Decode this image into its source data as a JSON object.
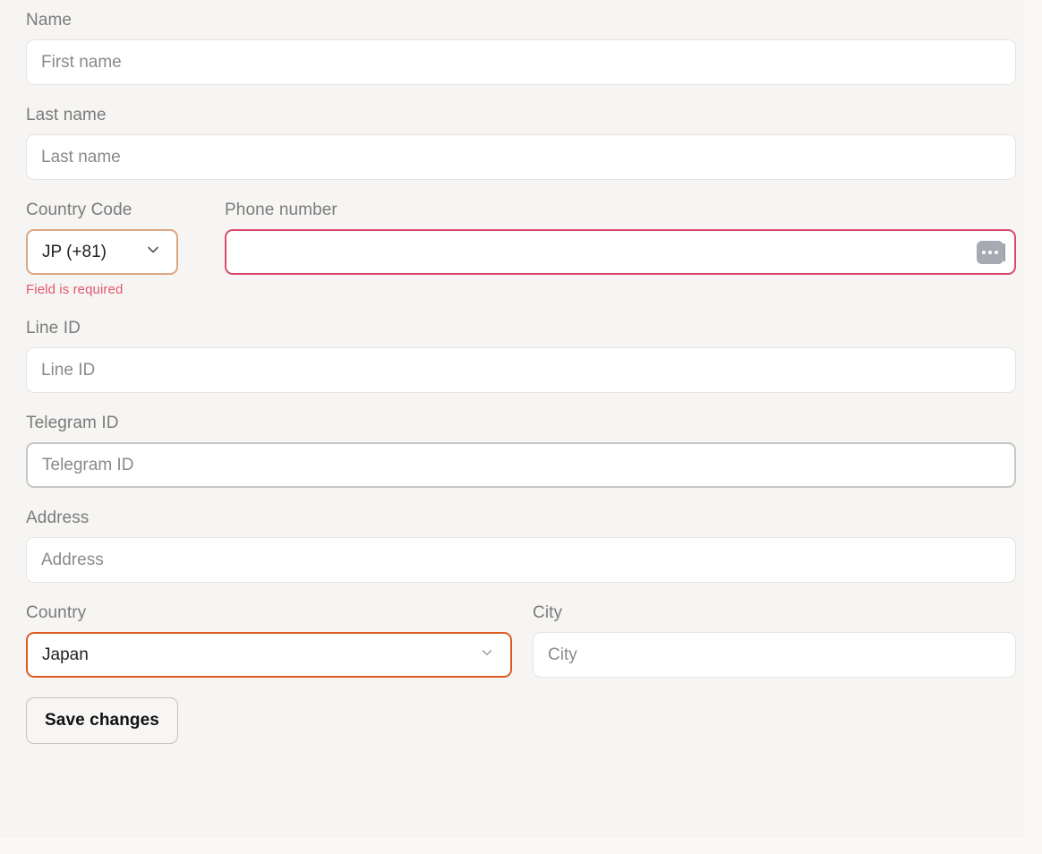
{
  "form": {
    "fields": {
      "name": {
        "label": "Name",
        "placeholder": "First name",
        "value": ""
      },
      "last_name": {
        "label": "Last name",
        "placeholder": "Last name",
        "value": ""
      },
      "country_code": {
        "label": "Country Code",
        "selected": "JP (+81)",
        "error": "Field is required"
      },
      "phone_number": {
        "label": "Phone number",
        "placeholder": "",
        "value": "",
        "state": "invalid"
      },
      "line_id": {
        "label": "Line ID",
        "placeholder": "Line ID",
        "value": ""
      },
      "telegram_id": {
        "label": "Telegram ID",
        "placeholder": "Telegram ID",
        "value": "",
        "state": "hovered"
      },
      "address": {
        "label": "Address",
        "placeholder": "Address",
        "value": ""
      },
      "country": {
        "label": "Country",
        "selected": "Japan"
      },
      "city": {
        "label": "City",
        "placeholder": "City",
        "value": ""
      }
    },
    "actions": {
      "save_label": "Save changes"
    },
    "icons": {
      "chevron_country_code": "chevron-down-icon",
      "chevron_country": "chevron-down-icon",
      "password_manager": "password-manager-icon"
    },
    "colors": {
      "page_background": "#faf9f7",
      "card_background": "#f6f5f3",
      "input_background": "#ffffff",
      "input_border": "#e6e4e1",
      "label_text": "#7b7b7b",
      "placeholder_text": "#8a8a8a",
      "error_border": "#dc4a6b",
      "error_text": "#e2576f",
      "accent_soft": "#dca77f",
      "accent_strong": "#da5c22",
      "hover_border": "#c9c7c4",
      "button_text": "#111111",
      "button_border": "#c3c1be"
    }
  }
}
